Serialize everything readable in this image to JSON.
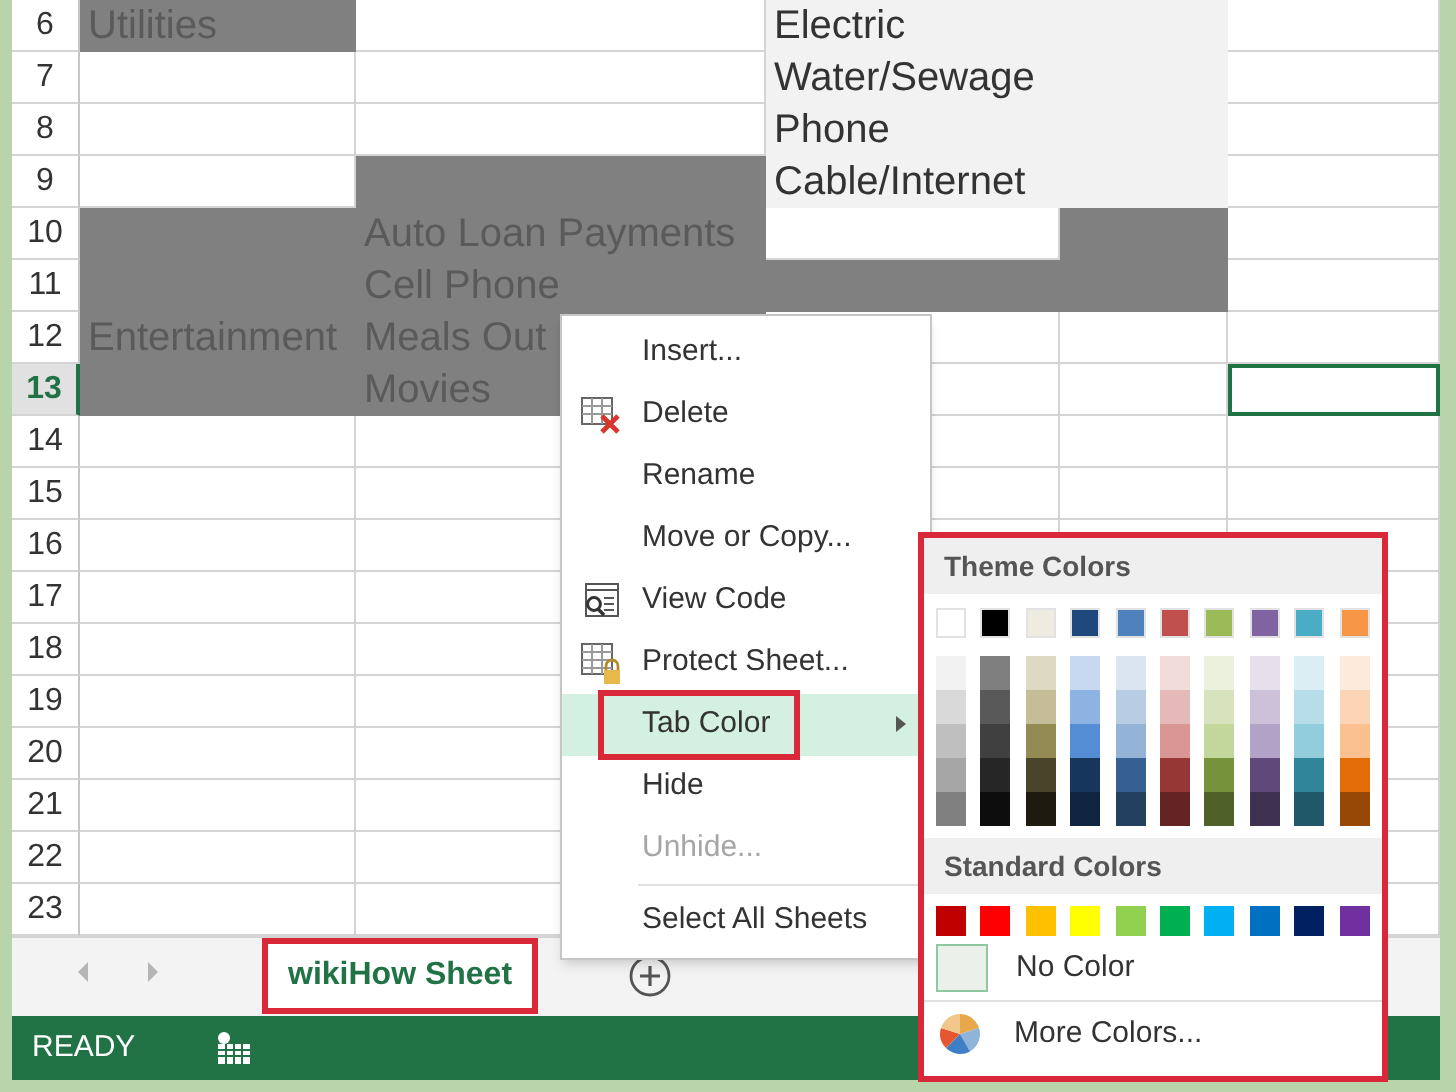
{
  "rows": [
    {
      "number": "6",
      "selected": false,
      "cells": [
        {
          "text": "Utilities",
          "color": "#808080"
        },
        {
          "color": "#ffffff"
        },
        {
          "text": "Electric",
          "color": "#f2f2f2"
        },
        {
          "color": "#f2f2f2"
        },
        {
          "color": "#ffffff"
        }
      ]
    },
    {
      "number": "7",
      "selected": false,
      "cells": [
        {
          "color": "#ffffff"
        },
        {
          "color": "#ffffff"
        },
        {
          "text": "Water/Sewage",
          "color": "#f2f2f2"
        },
        {
          "color": "#f2f2f2"
        },
        {
          "color": "#ffffff"
        }
      ]
    },
    {
      "number": "8",
      "selected": false,
      "cells": [
        {
          "color": "#ffffff"
        },
        {
          "color": "#ffffff"
        },
        {
          "text": "Phone",
          "color": "#f2f2f2"
        },
        {
          "color": "#f2f2f2"
        },
        {
          "color": "#ffffff"
        }
      ]
    },
    {
      "number": "9",
      "selected": false,
      "cells": [
        {
          "color": "#ffffff"
        },
        {
          "color": "#808080"
        },
        {
          "text": "Cable/Internet",
          "color": "#f2f2f2"
        },
        {
          "color": "#f2f2f2"
        },
        {
          "color": "#ffffff"
        }
      ]
    },
    {
      "number": "10",
      "selected": false,
      "cells": [
        {
          "color": "#808080"
        },
        {
          "text": "Auto Loan Payments",
          "color": "#808080"
        },
        {
          "color": "#ffffff"
        },
        {
          "color": "#808080"
        },
        {
          "color": "#ffffff"
        }
      ]
    },
    {
      "number": "11",
      "selected": false,
      "cells": [
        {
          "color": "#808080"
        },
        {
          "text": "Cell Phone",
          "color": "#808080"
        },
        {
          "color": "#808080"
        },
        {
          "color": "#808080"
        },
        {
          "color": "#ffffff"
        }
      ]
    },
    {
      "number": "12",
      "selected": false,
      "cells": [
        {
          "text": "Entertainment",
          "color": "#808080"
        },
        {
          "text": "Meals Out",
          "color": "#808080"
        },
        {
          "color": "#ffffff"
        },
        {
          "color": "#ffffff"
        },
        {
          "color": "#ffffff"
        }
      ]
    },
    {
      "number": "13",
      "selected": true,
      "cells": [
        {
          "color": "#808080"
        },
        {
          "text": "Movies",
          "color": "#808080"
        },
        {
          "color": "#ffffff"
        },
        {
          "color": "#ffffff"
        },
        {
          "color": "#ffffff"
        }
      ]
    },
    {
      "number": "14",
      "selected": false
    },
    {
      "number": "15",
      "selected": false
    },
    {
      "number": "16",
      "selected": false
    },
    {
      "number": "17",
      "selected": false
    },
    {
      "number": "18",
      "selected": false
    },
    {
      "number": "19",
      "selected": false
    },
    {
      "number": "20",
      "selected": false
    },
    {
      "number": "21",
      "selected": false
    },
    {
      "number": "22",
      "selected": false
    },
    {
      "number": "23",
      "selected": false
    }
  ],
  "context_menu": {
    "items": [
      {
        "label": "Insert...",
        "disabled": false,
        "selected": false,
        "submenu": false
      },
      {
        "label": "Delete",
        "disabled": false,
        "selected": false,
        "submenu": false
      },
      {
        "label": "Rename",
        "disabled": false,
        "selected": false,
        "submenu": false
      },
      {
        "label": "Move or Copy...",
        "disabled": false,
        "selected": false,
        "submenu": false
      },
      {
        "label": "View Code",
        "disabled": false,
        "selected": false,
        "submenu": false
      },
      {
        "label": "Protect Sheet...",
        "disabled": false,
        "selected": false,
        "submenu": false
      },
      {
        "label": "Tab Color",
        "disabled": false,
        "selected": true,
        "submenu": true
      },
      {
        "label": "Hide",
        "disabled": false,
        "selected": false,
        "submenu": false
      },
      {
        "label": "Unhide...",
        "disabled": true,
        "selected": false,
        "submenu": false
      },
      {
        "label": "Select All Sheets",
        "disabled": false,
        "selected": false,
        "submenu": false
      }
    ]
  },
  "color_palette": {
    "theme_title": "Theme Colors",
    "theme_colors": [
      {
        "color": "#ffffff",
        "shades": [
          {
            "color": "#f2f2f2"
          },
          {
            "color": "#d9d9d9"
          },
          {
            "color": "#bfbfbf"
          },
          {
            "color": "#a6a6a6"
          },
          {
            "color": "#808080"
          }
        ]
      },
      {
        "color": "#000000",
        "shades": [
          {
            "color": "#7f7f7f"
          },
          {
            "color": "#595959"
          },
          {
            "color": "#404040"
          },
          {
            "color": "#262626"
          },
          {
            "color": "#0d0d0d"
          }
        ]
      },
      {
        "color": "#eeece1",
        "shades": [
          {
            "color": "#ddd9c3"
          },
          {
            "color": "#c4bd97"
          },
          {
            "color": "#948a54"
          },
          {
            "color": "#4a452a"
          },
          {
            "color": "#1d1b10"
          }
        ]
      },
      {
        "color": "#1f497d",
        "shades": [
          {
            "color": "#c6d9f0"
          },
          {
            "color": "#8db3e2"
          },
          {
            "color": "#548dd4"
          },
          {
            "color": "#17365d"
          },
          {
            "color": "#0f243e"
          }
        ]
      },
      {
        "color": "#4f81bd",
        "shades": [
          {
            "color": "#dbe5f1"
          },
          {
            "color": "#b8cce4"
          },
          {
            "color": "#95b3d7"
          },
          {
            "color": "#366092"
          },
          {
            "color": "#244061"
          }
        ]
      },
      {
        "color": "#c0504d",
        "shades": [
          {
            "color": "#f2dcdb"
          },
          {
            "color": "#e5b9b7"
          },
          {
            "color": "#d99694"
          },
          {
            "color": "#953734"
          },
          {
            "color": "#632423"
          }
        ]
      },
      {
        "color": "#9bbb59",
        "shades": [
          {
            "color": "#ebf1dd"
          },
          {
            "color": "#d7e3bc"
          },
          {
            "color": "#c3d69b"
          },
          {
            "color": "#76923c"
          },
          {
            "color": "#4f6128"
          }
        ]
      },
      {
        "color": "#8064a2",
        "shades": [
          {
            "color": "#e5e0ec"
          },
          {
            "color": "#ccc1d9"
          },
          {
            "color": "#b2a2c7"
          },
          {
            "color": "#5f497a"
          },
          {
            "color": "#3f3151"
          }
        ]
      },
      {
        "color": "#4bacc6",
        "shades": [
          {
            "color": "#dbeef3"
          },
          {
            "color": "#b7dde8"
          },
          {
            "color": "#92cddc"
          },
          {
            "color": "#31859b"
          },
          {
            "color": "#205867"
          }
        ]
      },
      {
        "color": "#f79646",
        "shades": [
          {
            "color": "#fdeada"
          },
          {
            "color": "#fbd5b5"
          },
          {
            "color": "#fac08f"
          },
          {
            "color": "#e36c09"
          },
          {
            "color": "#974806"
          }
        ]
      }
    ],
    "standard_title": "Standard Colors",
    "standard_colors": [
      {
        "color": "#c00000"
      },
      {
        "color": "#ff0000"
      },
      {
        "color": "#ffc000"
      },
      {
        "color": "#ffff00"
      },
      {
        "color": "#92d050"
      },
      {
        "color": "#00b050"
      },
      {
        "color": "#00b0f0"
      },
      {
        "color": "#0070c0"
      },
      {
        "color": "#002060"
      },
      {
        "color": "#7030a0"
      }
    ],
    "no_color": "No Color",
    "more_colors": "More Colors..."
  },
  "sheet_tabs": [
    {
      "label": "wikiHow Sheet",
      "selected": true
    }
  ],
  "status_bar": {
    "status": "READY"
  }
}
